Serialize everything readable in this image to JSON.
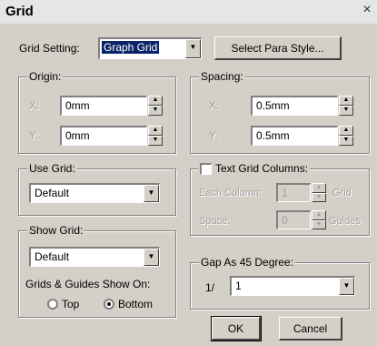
{
  "window": {
    "title": "Grid",
    "close_glyph": "×"
  },
  "grid_setting": {
    "label": "Grid Setting:",
    "value": "Graph Grid",
    "button": "Select Para Style..."
  },
  "origin": {
    "legend": "Origin:",
    "x_label": "X:",
    "x_value": "0mm",
    "y_label": "Y:",
    "y_value": "0mm"
  },
  "spacing": {
    "legend": "Spacing:",
    "x_label": "X:",
    "x_value": "0.5mm",
    "y_label": "Y:",
    "y_value": "0.5mm"
  },
  "use_grid": {
    "legend": "Use Grid:",
    "value": "Default"
  },
  "text_grid": {
    "legend": "Text Grid Columns:",
    "each_column_label": "Each Column:",
    "each_column_value": "1",
    "each_column_unit": "Grid",
    "space_label": "Space:",
    "space_value": "0",
    "space_unit": "Guides"
  },
  "show_grid": {
    "legend": "Show Grid:",
    "value": "Default",
    "show_on_label": "Grids & Guides Show On:",
    "options": [
      "Top",
      "Bottom"
    ],
    "selected": "Bottom"
  },
  "gap": {
    "legend": "Gap As 45 Degree:",
    "prefix": "1/",
    "value": "1"
  },
  "buttons": {
    "ok": "OK",
    "cancel": "Cancel"
  }
}
